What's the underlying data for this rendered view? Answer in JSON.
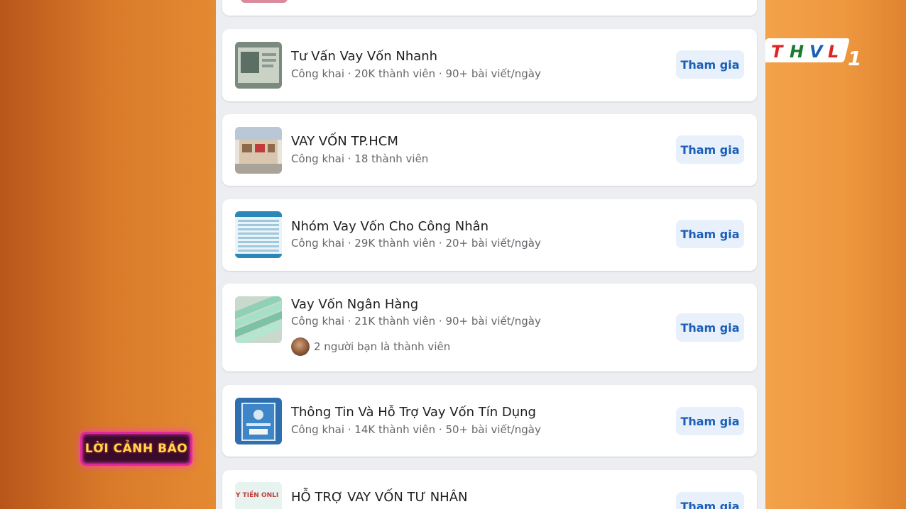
{
  "channel_logo": {
    "letters": [
      "T",
      "H",
      "V",
      "L"
    ],
    "number": "1"
  },
  "warning_badge": "LỜI CẢNH BÁO",
  "groups": [
    {
      "name": "Tư Vấn Vay Vốn Nhanh",
      "meta": "Công khai · 20K thành viên · 90+ bài viết/ngày",
      "join_label": "Tham gia"
    },
    {
      "name": "VAY VỐN TP.HCM",
      "meta": "Công khai · 18 thành viên",
      "join_label": "Tham gia"
    },
    {
      "name": "Nhóm Vay Vốn Cho Công Nhân",
      "meta": "Công khai · 29K thành viên · 20+ bài viết/ngày",
      "join_label": "Tham gia"
    },
    {
      "name": "Vay Vốn Ngân Hàng",
      "meta": "Công khai · 21K thành viên · 90+ bài viết/ngày",
      "friends": "2 người bạn là thành viên",
      "join_label": "Tham gia"
    },
    {
      "name": "Thông Tin Và Hỗ Trợ Vay Vốn Tín Dụng",
      "meta": "Công khai · 14K thành viên · 50+ bài viết/ngày",
      "join_label": "Tham gia"
    },
    {
      "name": "HỖ TRỢ VAY VỐN TƯ NHÂN",
      "thumb_text": "Y TIỀN ONLI",
      "join_label": "Tham gia"
    }
  ]
}
